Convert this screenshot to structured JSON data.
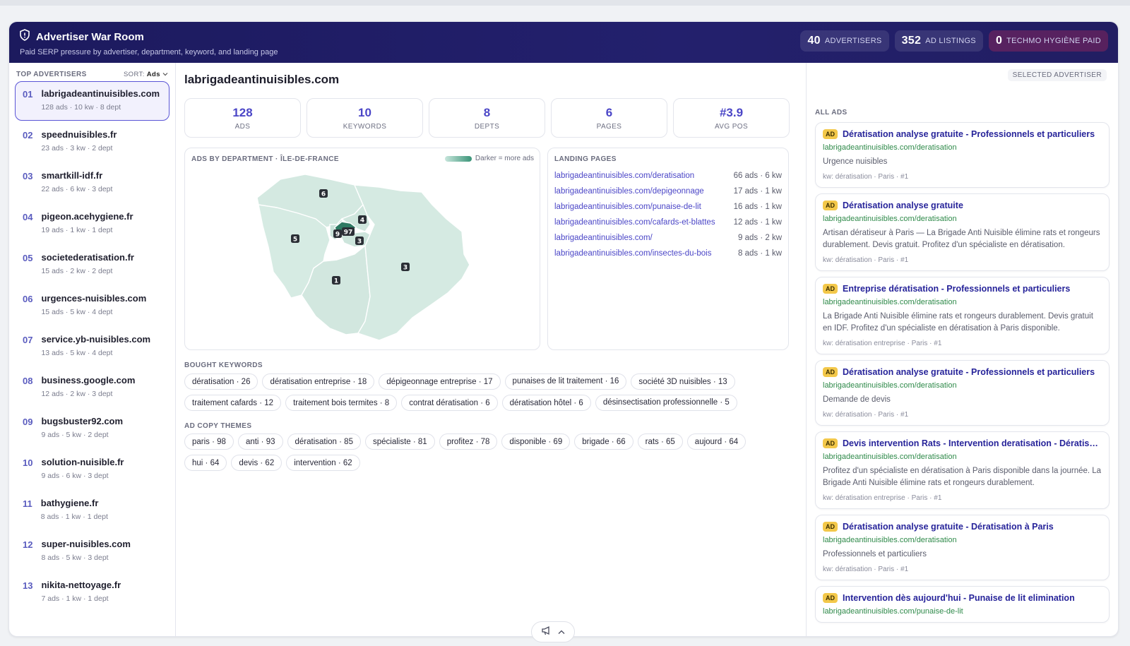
{
  "header": {
    "title": "Advertiser War Room",
    "subtitle": "Paid SERP pressure by advertiser, department, keyword, and landing page",
    "stats": [
      {
        "value": "40",
        "label": "ADVERTISERS"
      },
      {
        "value": "352",
        "label": "AD LISTINGS"
      },
      {
        "value": "0",
        "label": "TECHMO HYGIÈNE PAID"
      }
    ]
  },
  "sidebar": {
    "heading": "TOP ADVERTISERS",
    "sort_label": "SORT:",
    "sort_value": "Ads",
    "items": [
      {
        "rank": "01",
        "name": "labrigadeantinuisibles.com",
        "meta": "128 ads · 10 kw · 8 dept"
      },
      {
        "rank": "02",
        "name": "speednuisibles.fr",
        "meta": "23 ads · 3 kw · 2 dept"
      },
      {
        "rank": "03",
        "name": "smartkill-idf.fr",
        "meta": "22 ads · 6 kw · 3 dept"
      },
      {
        "rank": "04",
        "name": "pigeon.acehygiene.fr",
        "meta": "19 ads · 1 kw · 1 dept"
      },
      {
        "rank": "05",
        "name": "societederatisation.fr",
        "meta": "15 ads · 2 kw · 2 dept"
      },
      {
        "rank": "06",
        "name": "urgences-nuisibles.com",
        "meta": "15 ads · 5 kw · 4 dept"
      },
      {
        "rank": "07",
        "name": "service.yb-nuisibles.com",
        "meta": "13 ads · 5 kw · 4 dept"
      },
      {
        "rank": "08",
        "name": "business.google.com",
        "meta": "12 ads · 2 kw · 3 dept"
      },
      {
        "rank": "09",
        "name": "bugsbuster92.com",
        "meta": "9 ads · 5 kw · 2 dept"
      },
      {
        "rank": "10",
        "name": "solution-nuisible.fr",
        "meta": "9 ads · 6 kw · 3 dept"
      },
      {
        "rank": "11",
        "name": "bathygiene.fr",
        "meta": "8 ads · 1 kw · 1 dept"
      },
      {
        "rank": "12",
        "name": "super-nuisibles.com",
        "meta": "8 ads · 5 kw · 3 dept"
      },
      {
        "rank": "13",
        "name": "nikita-nettoyage.fr",
        "meta": "7 ads · 1 kw · 1 dept"
      }
    ]
  },
  "main": {
    "title": "labrigadeantinuisibles.com",
    "kpis": [
      {
        "value": "128",
        "label": "ADS"
      },
      {
        "value": "10",
        "label": "KEYWORDS"
      },
      {
        "value": "8",
        "label": "DEPTS"
      },
      {
        "value": "6",
        "label": "PAGES"
      },
      {
        "value": "#3.9",
        "label": "AVG POS"
      }
    ],
    "map": {
      "label": "ADS BY DEPARTMENT · ÎLE-DE-FRANCE",
      "legend": "Darker = more ads",
      "markers": [
        {
          "dept": "75",
          "count": 97
        },
        {
          "dept": "92",
          "count": 9
        },
        {
          "dept": "95",
          "count": 6
        },
        {
          "dept": "78",
          "count": 5
        },
        {
          "dept": "93",
          "count": 4
        },
        {
          "dept": "94",
          "count": 3
        },
        {
          "dept": "77",
          "count": 3
        },
        {
          "dept": "91",
          "count": 1
        }
      ]
    },
    "landing": {
      "label": "LANDING PAGES",
      "rows": [
        {
          "url": "labrigadeantinuisibles.com/deratisation",
          "count": "66 ads · 6 kw"
        },
        {
          "url": "labrigadeantinuisibles.com/depigeonnage",
          "count": "17 ads · 1 kw"
        },
        {
          "url": "labrigadeantinuisibles.com/punaise-de-lit",
          "count": "16 ads · 1 kw"
        },
        {
          "url": "labrigadeantinuisibles.com/cafards-et-blattes",
          "count": "12 ads · 1 kw"
        },
        {
          "url": "labrigadeantinuisibles.com/",
          "count": "9 ads · 2 kw"
        },
        {
          "url": "labrigadeantinuisibles.com/insectes-du-bois",
          "count": "8 ads · 1 kw"
        }
      ]
    },
    "keywords_label": "BOUGHT KEYWORDS",
    "keywords": [
      "dératisation · 26",
      "dératisation entreprise · 18",
      "dépigeonnage entreprise · 17",
      "punaises de lit traitement · 16",
      "société 3D nuisibles · 13",
      "traitement cafards · 12",
      "traitement bois termites · 8",
      "contrat dératisation · 6",
      "dératisation hôtel · 6",
      "désinsectisation professionnelle · 5"
    ],
    "themes_label": "AD COPY THEMES",
    "themes": [
      "paris · 98",
      "anti · 93",
      "dératisation · 85",
      "spécialiste · 81",
      "profitez · 78",
      "disponible · 69",
      "brigade · 66",
      "rats · 65",
      "aujourd · 64",
      "hui · 64",
      "devis · 62",
      "intervention · 62"
    ]
  },
  "ads_panel": {
    "selected_label": "SELECTED ADVERTISER",
    "label": "ALL ADS",
    "badge": "AD",
    "ads": [
      {
        "title": "Dératisation analyse gratuite - Professionnels et particuliers",
        "url": "labrigadeantinuisibles.com/deratisation",
        "desc": "Urgence nuisibles",
        "kw": "kw: dératisation · Paris · #1"
      },
      {
        "title": "Dératisation analyse gratuite",
        "url": "labrigadeantinuisibles.com/deratisation",
        "desc": "Artisan dératiseur à Paris — La Brigade Anti Nuisible élimine rats et rongeurs durablement. Devis gratuit. Profitez d'un spécialiste en dératisation.",
        "kw": "kw: dératisation · Paris · #1"
      },
      {
        "title": "Entreprise dératisation - Professionnels et particuliers",
        "url": "labrigadeantinuisibles.com/deratisation",
        "desc": "La Brigade Anti Nuisible élimine rats et rongeurs durablement. Devis gratuit en IDF. Profitez d'un spécialiste en dératisation à Paris disponible.",
        "kw": "kw: dératisation entreprise · Paris · #1"
      },
      {
        "title": "Dératisation analyse gratuite - Professionnels et particuliers",
        "url": "labrigadeantinuisibles.com/deratisation",
        "desc": "Demande de devis",
        "kw": "kw: dératisation · Paris · #1"
      },
      {
        "title": "Devis intervention Rats - Intervention deratisation - Dératisation",
        "url": "labrigadeantinuisibles.com/deratisation",
        "desc": "Profitez d'un spécialiste en dératisation à Paris disponible dans la journée. La Brigade Anti Nuisible élimine rats et rongeurs durablement.",
        "kw": "kw: dératisation entreprise · Paris · #1"
      },
      {
        "title": "Dératisation analyse gratuite - Dératisation à Paris",
        "url": "labrigadeantinuisibles.com/deratisation",
        "desc": "Professionnels et particuliers",
        "kw": "kw: dératisation · Paris · #1"
      },
      {
        "title": "Intervention dès aujourd'hui - Punaise de lit elimination",
        "url": "labrigadeantinuisibles.com/punaise-de-lit",
        "desc": "",
        "kw": ""
      }
    ]
  },
  "colors": {
    "accent": "#4b46c7",
    "header_bg": "#1c1a5e",
    "ad_badge": "#f3c84a",
    "url_green": "#2f8a4a",
    "map_fill": "#d6ebe4",
    "map_dark": "#2f7a63"
  }
}
